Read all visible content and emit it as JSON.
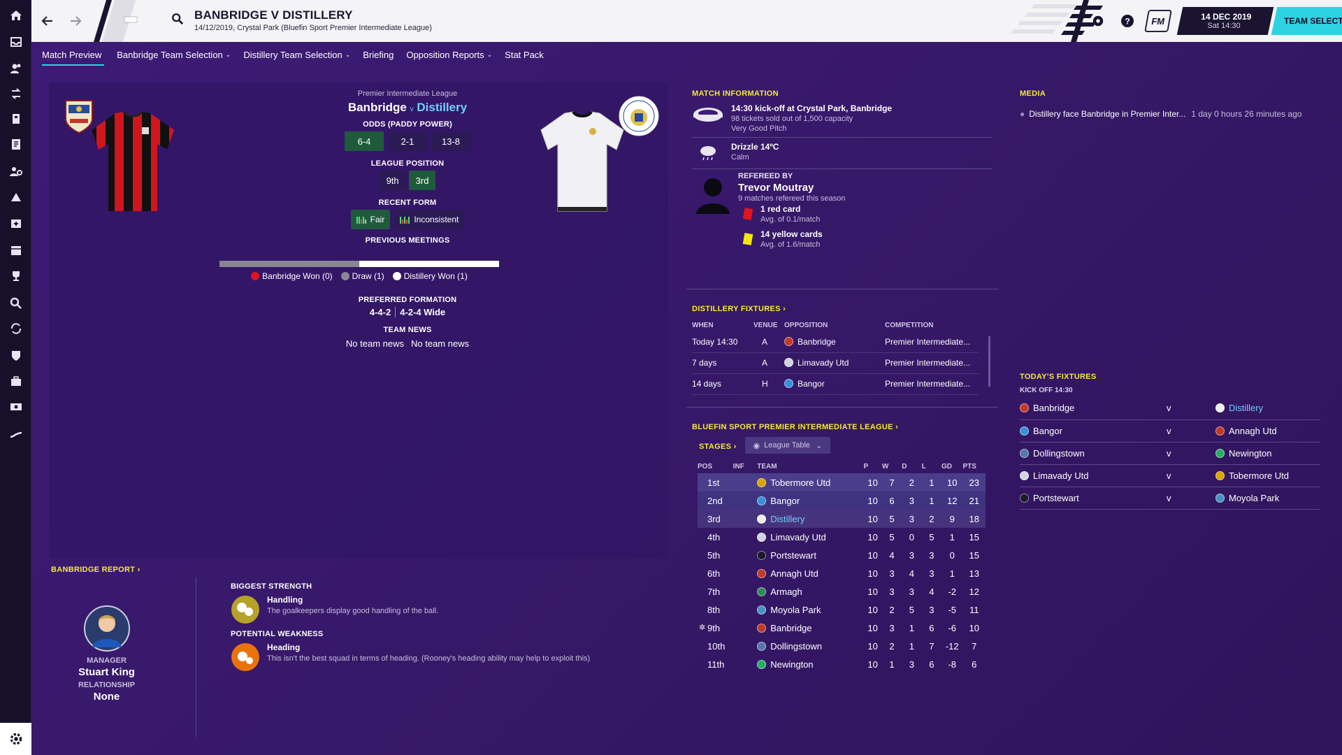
{
  "header": {
    "title": "BANBRIDGE V DISTILLERY",
    "subtitle": "14/12/2019, Crystal Park (Bluefin Sport Premier Intermediate League)",
    "fm_label": "FM",
    "date": "14 DEC 2019",
    "day_time": "Sat 14:30",
    "team_selection": "TEAM SELECTION"
  },
  "subnav": {
    "tabs": [
      {
        "label": "Match Preview",
        "active": true
      },
      {
        "label": "Banbridge Team Selection",
        "dropdown": true
      },
      {
        "label": "Distillery Team Selection",
        "dropdown": true
      },
      {
        "label": "Briefing"
      },
      {
        "label": "Opposition Reports",
        "dropdown": true
      },
      {
        "label": "Stat Pack"
      }
    ]
  },
  "preview": {
    "competition": "Premier Intermediate League",
    "home": "Banbridge",
    "v": "v",
    "away": "Distillery",
    "odds_label": "ODDS (PADDY POWER)",
    "odds": [
      "6-4",
      "2-1",
      "13-8"
    ],
    "league_position_label": "LEAGUE POSITION",
    "positions": [
      "9th",
      "3rd"
    ],
    "recent_form_label": "RECENT FORM",
    "form_home": "Fair",
    "form_away": "Inconsistent",
    "previous_meetings_label": "PREVIOUS MEETINGS",
    "meetings": {
      "home_won": "Banbridge Won (0)",
      "draw": "Draw (1)",
      "away_won": "Distillery Won (1)",
      "draw_share": 0.5,
      "away_share": 0.5
    },
    "preferred_formation_label": "PREFERRED FORMATION",
    "formation_home": "4-4-2",
    "formation_away": "4-2-4 Wide",
    "team_news_label": "TEAM NEWS",
    "news_home": "No team news",
    "news_away": "No team news"
  },
  "report": {
    "title": "BANBRIDGE REPORT",
    "manager_label": "MANAGER",
    "manager_name": "Stuart King",
    "relationship_label": "RELATIONSHIP",
    "relationship": "None",
    "strength_label": "BIGGEST STRENGTH",
    "strength_title": "Handling",
    "strength_text": "The goalkeepers display good handling of the ball.",
    "weakness_label": "POTENTIAL WEAKNESS",
    "weakness_title": "Heading",
    "weakness_text": "This isn't the best squad in terms of heading. (Rooney's heading ability may help to exploit this)"
  },
  "match_info": {
    "title": "MATCH INFORMATION",
    "kickoff": "14:30 kick-off at Crystal Park, Banbridge",
    "tickets": "98 tickets sold out of 1,500 capacity",
    "pitch": "Very Good Pitch",
    "weather": "Drizzle 14ºC",
    "wind": "Calm",
    "refereed_by": "REFEREED BY",
    "referee": "Trevor Moutray",
    "ref_matches": "9 matches refereed this season",
    "red": "1 red card",
    "red_avg": "Avg. of 0.1/match",
    "yellow": "14 yellow cards",
    "yellow_avg": "Avg. of 1.6/match"
  },
  "fixtures": {
    "title": "DISTILLERY FIXTURES",
    "headers": [
      "WHEN",
      "VENUE",
      "OPPOSITION",
      "COMPETITION"
    ],
    "rows": [
      {
        "when": "Today 14:30",
        "venue": "A",
        "opp": "Banbridge",
        "comp": "Premier Intermediate...",
        "color": "#c0392b"
      },
      {
        "when": "7 days",
        "venue": "A",
        "opp": "Limavady Utd",
        "comp": "Premier Intermediate...",
        "color": "#d0d4e0"
      },
      {
        "when": "14 days",
        "venue": "H",
        "opp": "Bangor",
        "comp": "Premier Intermediate...",
        "color": "#3a8fd8"
      }
    ]
  },
  "league": {
    "title": "BLUEFIN SPORT PREMIER INTERMEDIATE LEAGUE",
    "stages": "STAGES",
    "view": "League Table",
    "headers": [
      "POS",
      "INF",
      "TEAM",
      "P",
      "W",
      "D",
      "L",
      "GD",
      "PTS"
    ],
    "rows": [
      {
        "pos": "1st",
        "team": "Tobermore Utd",
        "p": "10",
        "w": "7",
        "d": "2",
        "l": "1",
        "gd": "10",
        "pts": "23",
        "color": "#d9a400"
      },
      {
        "pos": "2nd",
        "team": "Bangor",
        "p": "10",
        "w": "6",
        "d": "3",
        "l": "1",
        "gd": "12",
        "pts": "21",
        "color": "#3a8fd8"
      },
      {
        "pos": "3rd",
        "team": "Distillery",
        "p": "10",
        "w": "5",
        "d": "3",
        "l": "2",
        "gd": "9",
        "pts": "18",
        "color": "#eeeeee"
      },
      {
        "pos": "4th",
        "team": "Limavady Utd",
        "p": "10",
        "w": "5",
        "d": "0",
        "l": "5",
        "gd": "1",
        "pts": "15",
        "color": "#d0d4e0"
      },
      {
        "pos": "5th",
        "team": "Portstewart",
        "p": "10",
        "w": "4",
        "d": "3",
        "l": "3",
        "gd": "0",
        "pts": "15",
        "color": "#1a1a2a"
      },
      {
        "pos": "6th",
        "team": "Annagh Utd",
        "p": "10",
        "w": "3",
        "d": "4",
        "l": "3",
        "gd": "1",
        "pts": "13",
        "color": "#c0392b"
      },
      {
        "pos": "7th",
        "team": "Armagh",
        "p": "10",
        "w": "3",
        "d": "3",
        "l": "4",
        "gd": "-2",
        "pts": "12",
        "color": "#2e8b57"
      },
      {
        "pos": "8th",
        "team": "Moyola Park",
        "p": "10",
        "w": "2",
        "d": "5",
        "l": "3",
        "gd": "-5",
        "pts": "11",
        "color": "#4a90c0"
      },
      {
        "pos": "9th",
        "team": "Banbridge",
        "p": "10",
        "w": "3",
        "d": "1",
        "l": "6",
        "gd": "-6",
        "pts": "10",
        "color": "#c0392b"
      },
      {
        "pos": "10th",
        "team": "Dollingstown",
        "p": "10",
        "w": "2",
        "d": "1",
        "l": "7",
        "gd": "-12",
        "pts": "7",
        "color": "#5577aa"
      },
      {
        "pos": "11th",
        "team": "Newington",
        "p": "10",
        "w": "1",
        "d": "3",
        "l": "6",
        "gd": "-8",
        "pts": "6",
        "color": "#27ae60"
      }
    ]
  },
  "media": {
    "title": "MEDIA",
    "item": "Distillery face Banbridge in Premier Inter...",
    "time": "1 day 0 hours 26 minutes ago"
  },
  "todays_fixtures": {
    "title": "TODAY'S FIXTURES",
    "kickoff": "KICK OFF 14:30",
    "v": "v",
    "rows": [
      {
        "home": "Banbridge",
        "away": "Distillery",
        "hc": "#c0392b",
        "ac": "#eeeeee"
      },
      {
        "home": "Bangor",
        "away": "Annagh Utd",
        "hc": "#3a8fd8",
        "ac": "#c0392b"
      },
      {
        "home": "Dollingstown",
        "away": "Newington",
        "hc": "#5577aa",
        "ac": "#27ae60"
      },
      {
        "home": "Limavady Utd",
        "away": "Tobermore Utd",
        "hc": "#d0d4e0",
        "ac": "#d9a400"
      },
      {
        "home": "Portstewart",
        "away": "Moyola Park",
        "hc": "#1a1a2a",
        "ac": "#4a90c0"
      }
    ]
  },
  "colors": {
    "accent": "#2bd4e0",
    "heading": "#f5e93b",
    "link": "#6fd0ff",
    "bg": "#3a1a72"
  },
  "icons": [
    "home-icon",
    "inbox-icon",
    "squad-icon",
    "dynamics-icon",
    "staff-icon",
    "tactics-icon",
    "scouting-icon",
    "training-icon",
    "medical-icon",
    "schedule-icon",
    "competitions-icon",
    "search-icon",
    "transfers-icon",
    "club-icon",
    "finances-icon",
    "development-icon",
    "settings-icon"
  ]
}
